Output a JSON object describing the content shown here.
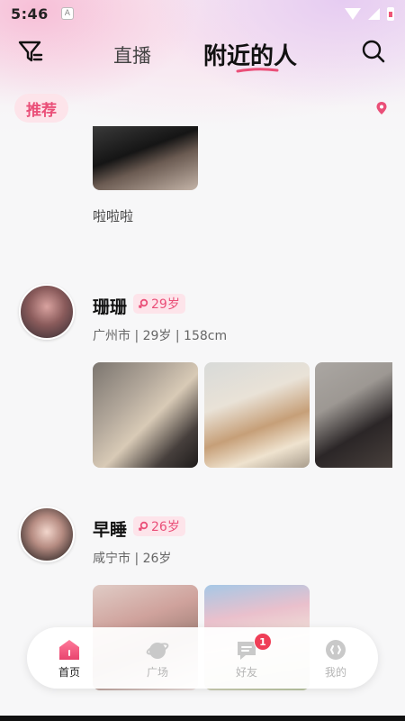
{
  "status_bar": {
    "time": "5:46",
    "notif_icon": "a-icon"
  },
  "header": {
    "tabs": [
      {
        "label": "直播",
        "active": false
      },
      {
        "label": "附近的人",
        "active": true
      }
    ],
    "filter_icon": "filter-icon",
    "search_icon": "search-icon"
  },
  "recommend": {
    "label": "推荐",
    "location_icon": "location-pin-icon"
  },
  "feed": [
    {
      "caption": "啦啦啦"
    },
    {
      "name": "珊珊",
      "age_badge": "29岁",
      "info": "广州市 | 29岁 | 158cm",
      "photo_count": 3
    },
    {
      "name": "早睡",
      "age_badge": "26岁",
      "info": "咸宁市 | 26岁",
      "photo_count": 2
    }
  ],
  "bottom_nav": {
    "items": [
      {
        "label": "首页",
        "icon": "home-icon",
        "active": true
      },
      {
        "label": "广场",
        "icon": "planet-icon",
        "active": false
      },
      {
        "label": "好友",
        "icon": "chat-icon",
        "active": false,
        "badge": "1"
      },
      {
        "label": "我的",
        "icon": "profile-icon",
        "active": false
      }
    ]
  },
  "colors": {
    "accent": "#ea4f78",
    "badge_bg": "#fde4ea",
    "notify": "#ef3e57"
  }
}
